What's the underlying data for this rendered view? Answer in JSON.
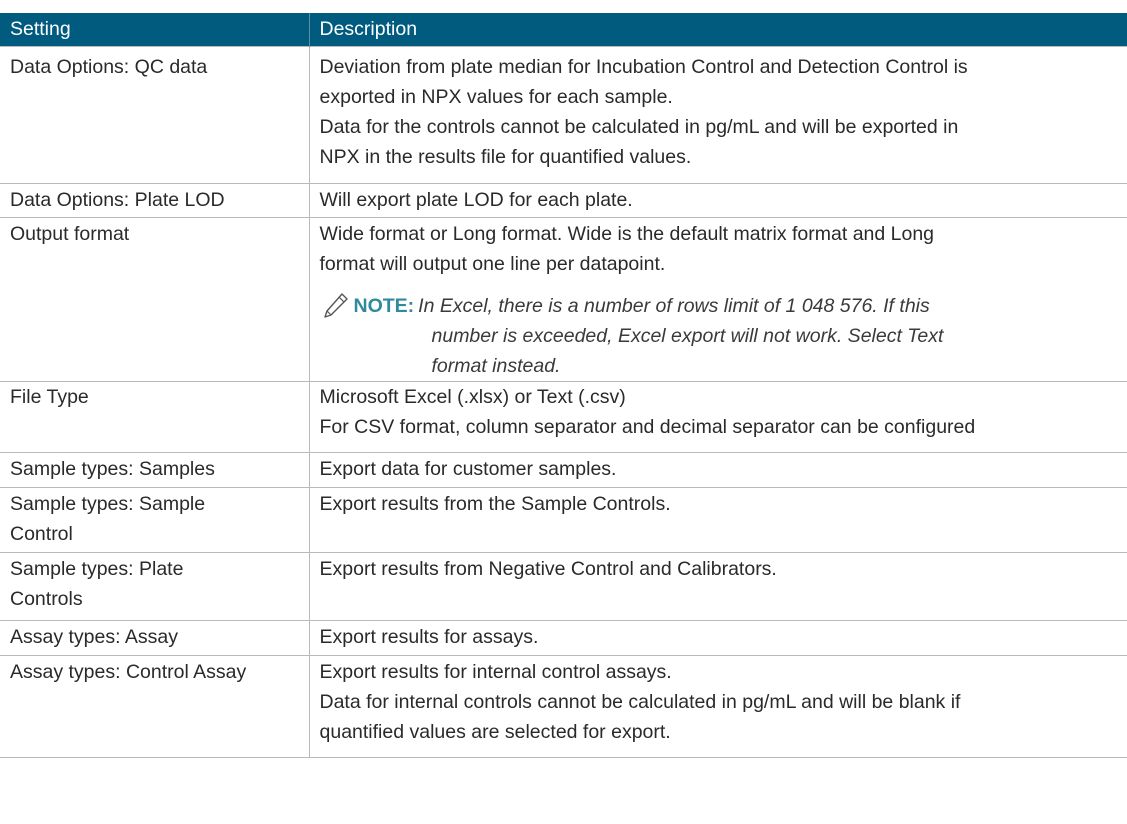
{
  "table": {
    "headers": {
      "setting": "Setting",
      "description": "Description"
    },
    "rows": [
      {
        "setting": "Data Options: QC data",
        "lines": [
          "Deviation from plate median for Incubation Control and Detection Control is",
          "exported in NPX values for each sample.",
          "Data for the controls cannot be calculated in pg/mL and will be exported in",
          "NPX in the results file for quantified values."
        ]
      },
      {
        "setting": "Data Options: Plate LOD",
        "lines": [
          "Will export plate LOD for each plate."
        ]
      },
      {
        "setting": "Output format",
        "lines": [
          "Wide format or Long format. Wide is the default matrix format and Long",
          "format will output one line per datapoint."
        ],
        "note": {
          "label": "NOTE:",
          "line1": "In Excel, there is a number of rows limit of 1 048 576. If this",
          "line2": "number is exceeded, Excel export will not work. Select Text",
          "line3": "format instead."
        }
      },
      {
        "setting": "File Type",
        "lines": [
          "Microsoft Excel (.xlsx) or Text (.csv)",
          "For CSV format, column separator and decimal separator can be configured"
        ]
      },
      {
        "setting": "Sample types: Samples",
        "lines": [
          "Export data for customer samples."
        ]
      },
      {
        "setting_lines": [
          "Sample types: Sample",
          "Control"
        ],
        "lines": [
          "Export results from the Sample Controls."
        ]
      },
      {
        "setting_lines": [
          "Sample types: Plate",
          "Controls"
        ],
        "lines": [
          "Export results from Negative Control and Calibrators."
        ]
      },
      {
        "setting": "Assay types: Assay",
        "lines": [
          "Export results for assays."
        ]
      },
      {
        "setting": "Assay types: Control Assay",
        "lines": [
          "Export results for internal control assays.",
          "Data for internal controls cannot be calculated in pg/mL and will be blank if",
          "quantified values are selected for export."
        ]
      }
    ]
  },
  "icons": {
    "note": "pencil-icon"
  },
  "colors": {
    "header_bg": "#005b7f",
    "note_label": "#2f8a9b"
  }
}
